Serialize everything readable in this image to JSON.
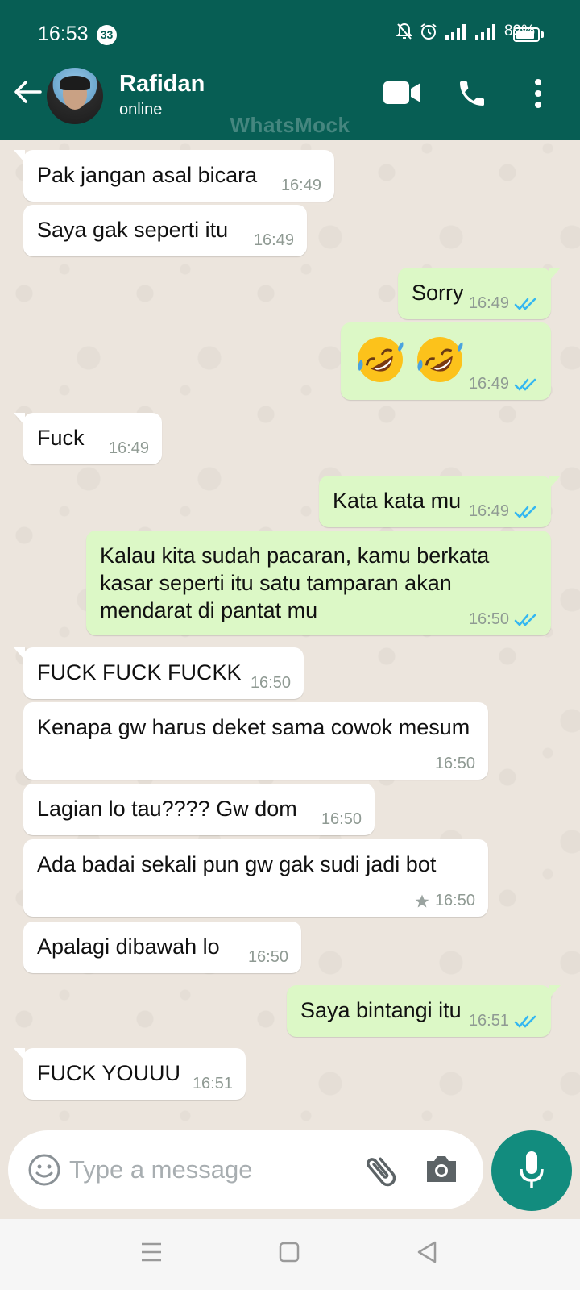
{
  "status_bar": {
    "time": "16:53",
    "notification_count": "33",
    "battery": "89%",
    "battery_level": 0.89,
    "icons": [
      "bell-off-icon",
      "alarm-icon",
      "signal-icon",
      "signal-icon",
      "battery-icon"
    ]
  },
  "header": {
    "contact_name": "Rafidan",
    "contact_status": "online",
    "watermark": "WhatsMock",
    "icons": [
      "back-arrow-icon",
      "video-call-icon",
      "phone-call-icon",
      "more-vert-icon"
    ]
  },
  "messages": [
    {
      "dir": "in",
      "text": "Pak jangan asal bicara",
      "time": "16:49"
    },
    {
      "dir": "in",
      "text": "Saya gak seperti itu",
      "time": "16:49"
    },
    {
      "dir": "out",
      "text": "Sorry",
      "time": "16:49",
      "read": true
    },
    {
      "dir": "out",
      "emoji": "rolling-on-the-floor-laughing",
      "emoji_count": 2,
      "time": "16:49",
      "read": true
    },
    {
      "dir": "in",
      "text": "Fuck",
      "time": "16:49"
    },
    {
      "dir": "out",
      "text": "Kata kata mu",
      "time": "16:49",
      "read": true
    },
    {
      "dir": "out",
      "text": "Kalau kita sudah pacaran, kamu berkata kasar seperti itu satu tamparan akan mendarat di pantat mu",
      "time": "16:50",
      "read": true
    },
    {
      "dir": "in",
      "text": "FUCK FUCK FUCKK",
      "time": "16:50"
    },
    {
      "dir": "in",
      "text": "Kenapa gw harus deket sama cowok mesum",
      "time": "16:50"
    },
    {
      "dir": "in",
      "text": "Lagian lo tau???? Gw dom",
      "time": "16:50"
    },
    {
      "dir": "in",
      "text": "Ada badai sekali pun gw gak sudi jadi bot",
      "time": "16:50",
      "starred": true
    },
    {
      "dir": "in",
      "text": "Apalagi dibawah lo",
      "time": "16:50"
    },
    {
      "dir": "out",
      "text": "Saya bintangi itu",
      "time": "16:51",
      "read": true
    },
    {
      "dir": "in",
      "text": "FUCK YOUUU",
      "time": "16:51"
    }
  ],
  "input": {
    "placeholder": "Type a message",
    "icons": [
      "emoji-icon",
      "attach-icon",
      "camera-icon",
      "mic-icon"
    ]
  },
  "nav_bar": {
    "icons": [
      "menu-icon",
      "home-icon",
      "back-icon"
    ]
  },
  "colors": {
    "header": "#075e54",
    "outgoing_bubble": "#dcf8c6",
    "incoming_bubble": "#ffffff",
    "read_ticks": "#34b7f1",
    "mic_button": "#128c7e",
    "chat_background": "#ece5dd"
  }
}
